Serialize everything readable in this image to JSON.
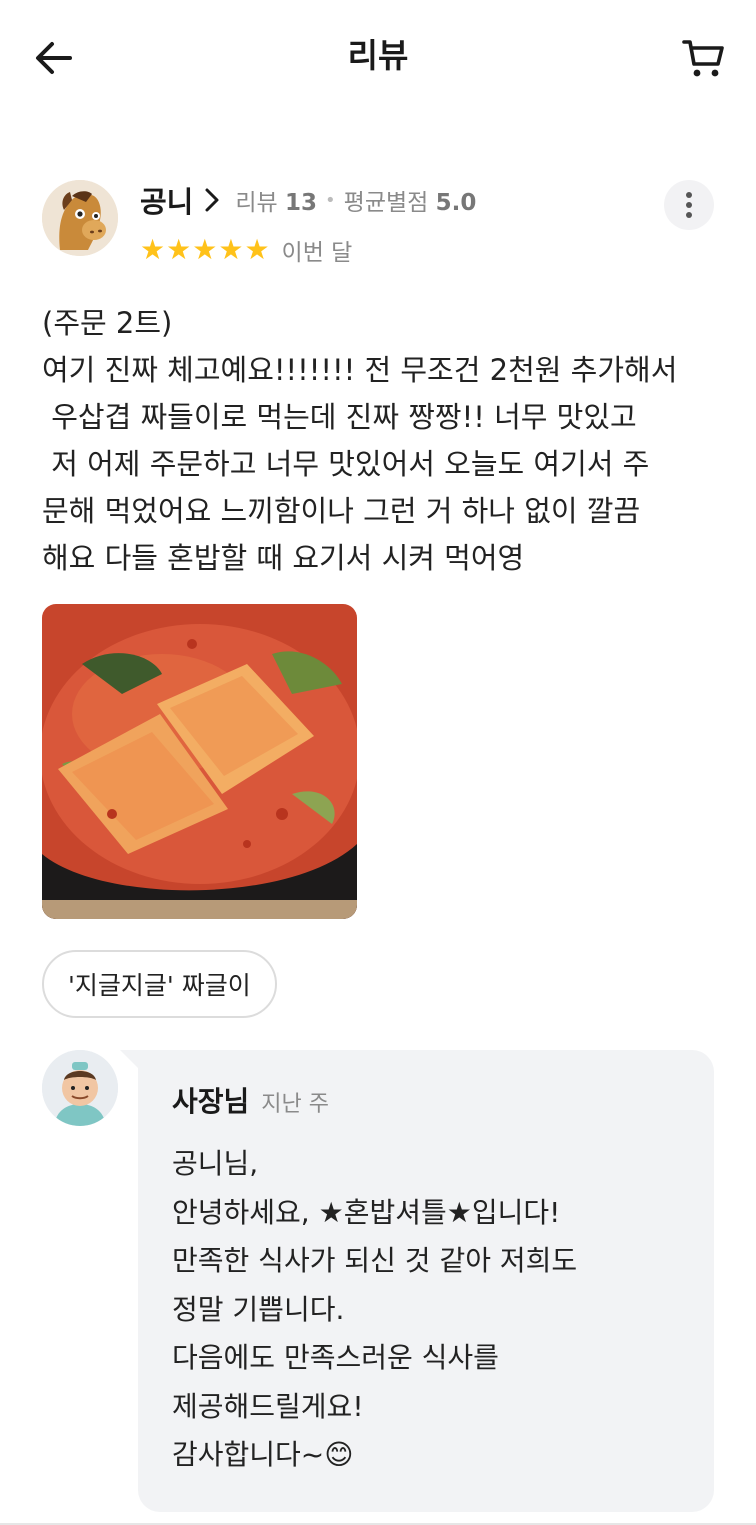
{
  "header": {
    "title": "리뷰",
    "back_icon": "arrow-left-icon",
    "cart_icon": "cart-icon"
  },
  "review": {
    "user_name": "공니",
    "review_count_label": "리뷰",
    "review_count": "13",
    "avg_rating_label": "평균별점",
    "avg_rating": "5.0",
    "stars": 5,
    "date": "이번 달",
    "text": "(주문 2트)\n여기 진짜 체고예요!!!!!!! 전 무조건 2천원 추가해서\n 우삽겹 짜들이로 먹는데 진짜 짱짱!! 너무 맛있고\n 저 어제 주문하고 너무 맛있어서 오늘도 여기서 주\n문해 먹었어요 느끼함이나 그런 거 하나 없이 깔끔\n해요 다들 혼밥할 때 요기서 시켜 먹어영",
    "photo_alt": "food-photo",
    "menu_tag": "'지글지글' 짜글이",
    "star_color": "#FFC21A"
  },
  "reply": {
    "owner_name": "사장님",
    "date": "지난 주",
    "text": "공니님,\n안녕하세요, ★혼밥셔틀★입니다!\n만족한 식사가 되신 것 같아 저희도\n정말 기쁩니다.\n다음에도 만족스러운 식사를\n제공해드릴게요!\n감사합니다~😊"
  }
}
